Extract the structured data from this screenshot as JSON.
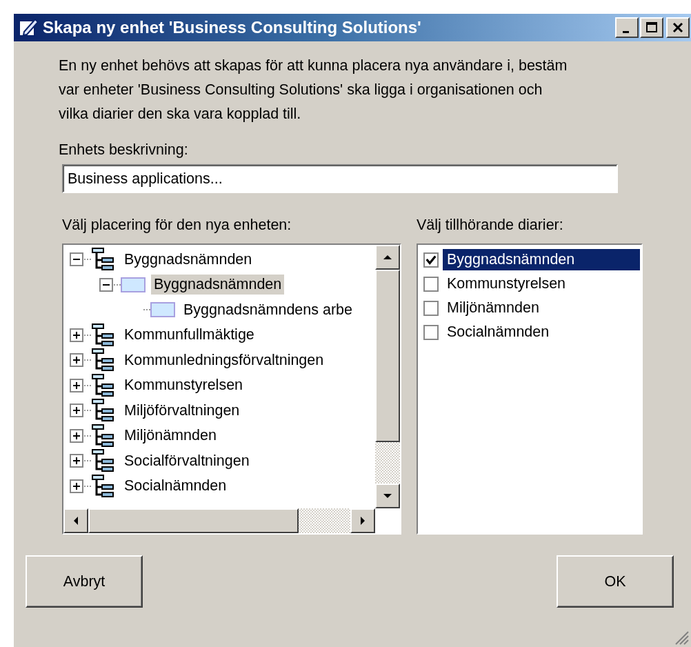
{
  "window": {
    "title": "Skapa ny enhet 'Business Consulting Solutions'"
  },
  "intro": "En ny enhet behövs att skapas för att kunna placera nya användare i, bestäm var enheter 'Business Consulting Solutions' ska ligga i organisationen och vilka diarier den ska vara kopplad till.",
  "description": {
    "label": "Enhets beskrivning:",
    "value": "Business applications..."
  },
  "tree": {
    "label": "Välj placering för den nya enheten:",
    "items": [
      {
        "label": "Byggnadsnämnden",
        "kind": "group",
        "expanded": true,
        "selected": false,
        "children": [
          {
            "label": "Byggnadsnämnden",
            "kind": "unit",
            "expanded": true,
            "selected": true,
            "children": [
              {
                "label": "Byggnadsnämndens arbe",
                "kind": "unit",
                "selected": false
              }
            ]
          }
        ]
      },
      {
        "label": "Kommunfullmäktige",
        "kind": "group",
        "expanded": false,
        "selected": false
      },
      {
        "label": "Kommunledningsförvaltningen",
        "kind": "group",
        "expanded": false,
        "selected": false
      },
      {
        "label": "Kommunstyrelsen",
        "kind": "group",
        "expanded": false,
        "selected": false
      },
      {
        "label": "Miljöförvaltningen",
        "kind": "group",
        "expanded": false,
        "selected": false
      },
      {
        "label": "Miljönämnden",
        "kind": "group",
        "expanded": false,
        "selected": false
      },
      {
        "label": "Socialförvaltningen",
        "kind": "group",
        "expanded": false,
        "selected": false
      },
      {
        "label": "Socialnämnden",
        "kind": "group",
        "expanded": false,
        "selected": false
      }
    ]
  },
  "diaries": {
    "label": "Välj tillhörande diarier:",
    "items": [
      {
        "label": "Byggnadsnämnden",
        "checked": true,
        "selected": true
      },
      {
        "label": "Kommunstyrelsen",
        "checked": false,
        "selected": false
      },
      {
        "label": "Miljönämnden",
        "checked": false,
        "selected": false
      },
      {
        "label": "Socialnämnden",
        "checked": false,
        "selected": false
      }
    ]
  },
  "buttons": [
    {
      "label": "Avbryt"
    },
    {
      "label": "OK"
    }
  ]
}
